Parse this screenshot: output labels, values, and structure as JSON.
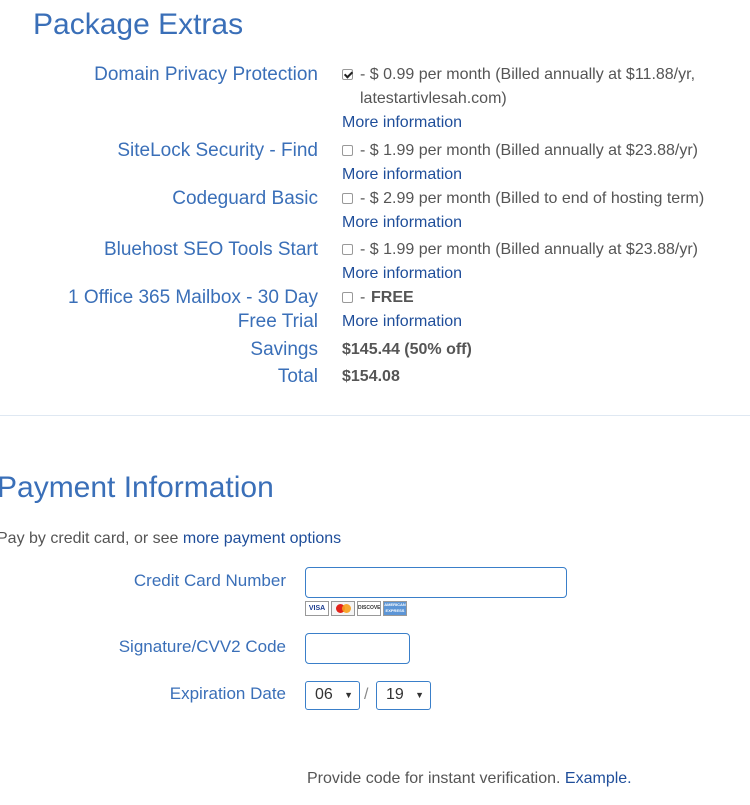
{
  "package_extras": {
    "title": "Package Extras",
    "items": [
      {
        "label": "Domain Privacy Protection",
        "checked": true,
        "price": "- $ 0.99 per month (Billed annually at $11.88/yr,",
        "price_line2": "latestartivlesah.com)",
        "more": "More information"
      },
      {
        "label": "SiteLock Security - Find",
        "checked": false,
        "price": "- $ 1.99 per month (Billed annually at $23.88/yr)",
        "more": "More information"
      },
      {
        "label": "Codeguard Basic",
        "checked": false,
        "price": "- $ 2.99 per month (Billed to end of hosting term)",
        "more": "More information"
      },
      {
        "label": "Bluehost SEO Tools Start",
        "checked": false,
        "price": "- $ 1.99 per month (Billed annually at $23.88/yr)",
        "more": "More information"
      },
      {
        "label_line1": "1 Office 365 Mailbox - 30 Day",
        "label_line2": "Free Trial",
        "checked": false,
        "dash": "-",
        "price_bold": "FREE",
        "more": "More information"
      }
    ],
    "savings_label": "Savings",
    "savings_value": "$145.44 (50% off)",
    "total_label": "Total",
    "total_value": "$154.08"
  },
  "payment": {
    "title": "Payment Information",
    "intro": "Pay by credit card, or see",
    "intro_link": "more payment options",
    "cc_label": "Credit Card Number",
    "cvv_label": "Signature/CVV2 Code",
    "exp_label": "Expiration Date",
    "exp_month": "06",
    "exp_year": "19",
    "exp_sep": "/",
    "card_brands": [
      "VISA",
      "MasterCard",
      "DISCOVER",
      "AMERICAN EXPRESS"
    ],
    "verify_text": "Provide code for instant verification.",
    "verify_link": "Example."
  },
  "colors": {
    "accent": "#3a6fb8",
    "link": "#1f4e9a",
    "input_border": "#3a7fc9"
  }
}
